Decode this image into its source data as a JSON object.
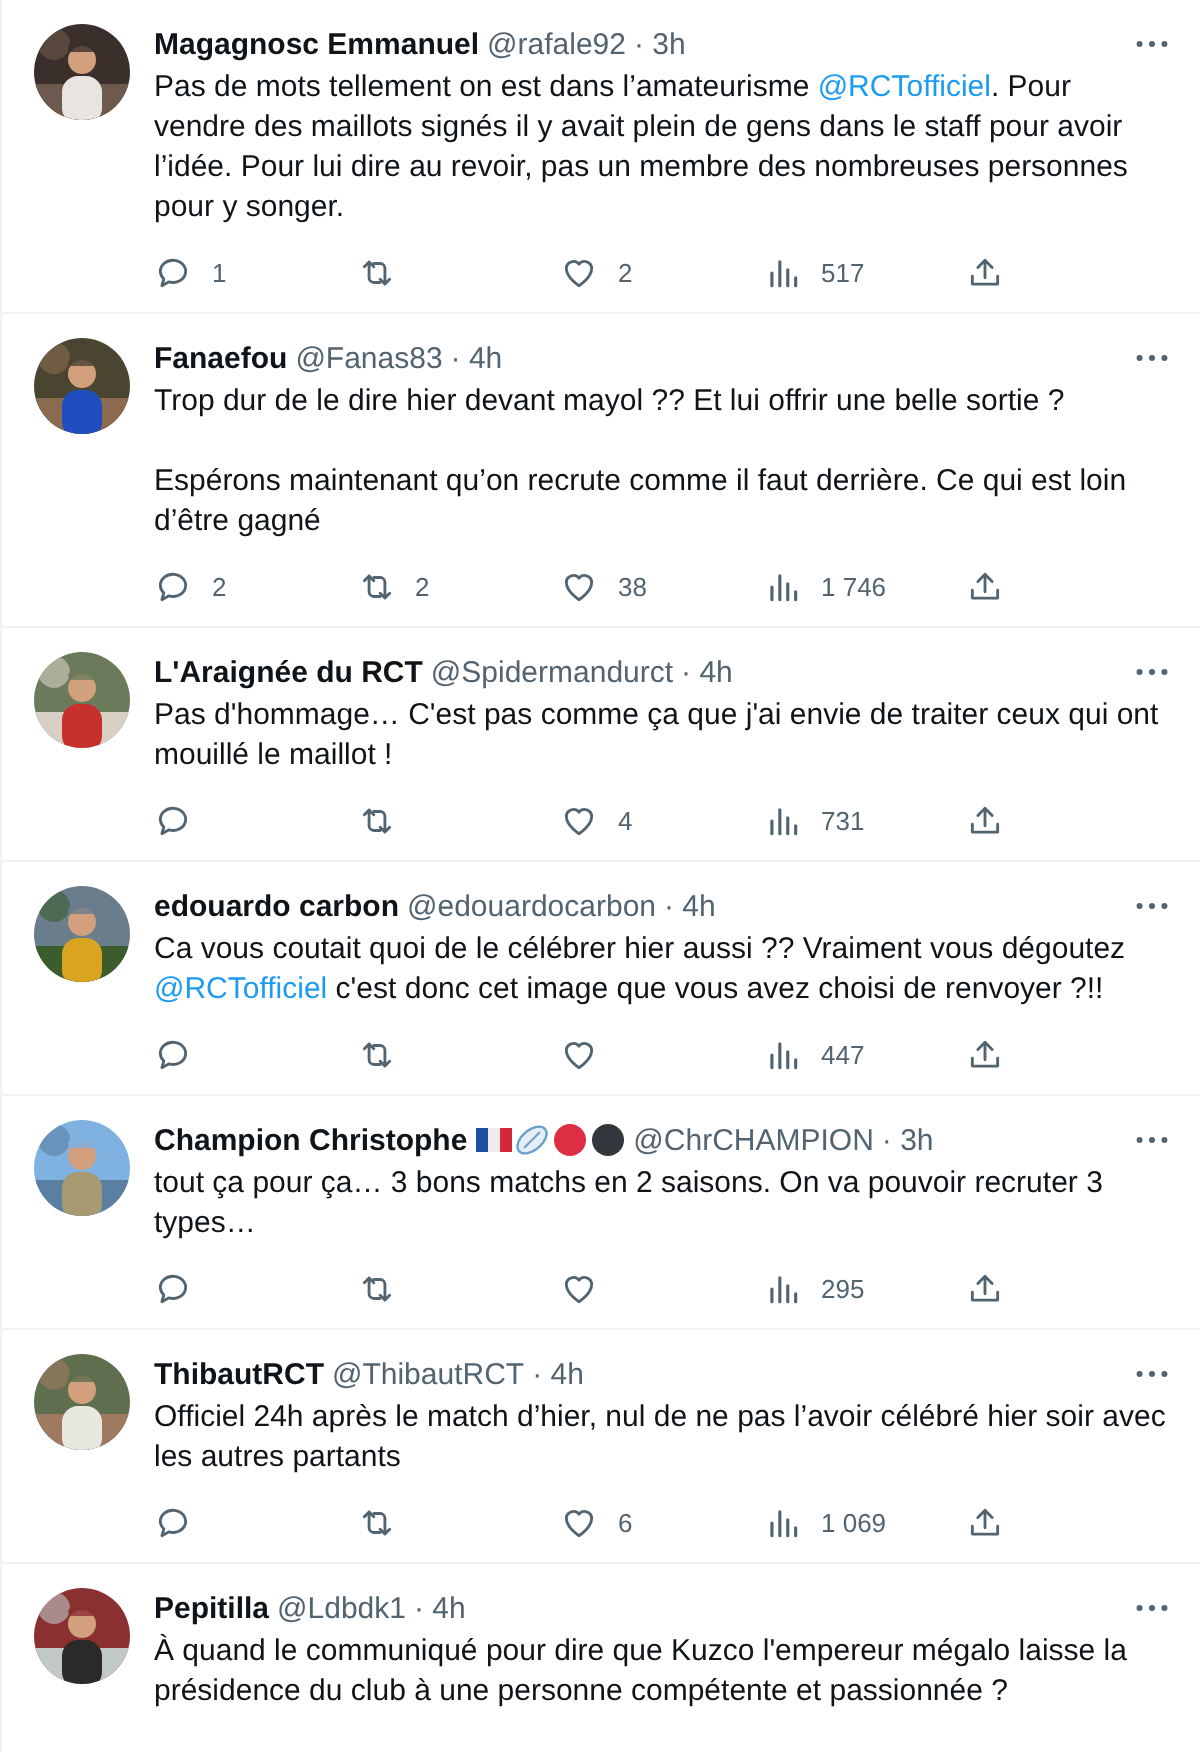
{
  "tweets": [
    {
      "name": "Magagnosc Emmanuel",
      "handle": "@rafale92",
      "time": "· 3h",
      "paragraphs": [
        [
          {
            "kind": "text",
            "text": "Pas de mots tellement on est dans l’amateurisme "
          },
          {
            "kind": "mention",
            "text": "@RCTofficiel"
          },
          {
            "kind": "text",
            "text": ". Pour vendre des maillots signés il y avait plein de gens dans le staff pour avoir l’idée. Pour lui dire au revoir, pas un membre des nombreuses personnes pour y songer."
          }
        ]
      ],
      "replies": "1",
      "likes": "2",
      "views": "517"
    },
    {
      "name": "Fanaefou",
      "handle": "@Fanas83",
      "time": "· 4h",
      "paragraphs": [
        [
          {
            "kind": "text",
            "text": "Trop dur de le dire hier devant mayol ?? Et lui offrir une belle sortie ?"
          }
        ],
        [
          {
            "kind": "text",
            "text": "Espérons maintenant qu’on recrute comme il faut derrière. Ce qui est loin d’être gagné"
          }
        ]
      ],
      "replies": "2",
      "retweets": "2",
      "likes": "38",
      "views": "1 746"
    },
    {
      "name": "L'Araignée du RCT",
      "handle": "@Spidermandurct",
      "time": "· 4h",
      "paragraphs": [
        [
          {
            "kind": "text",
            "text": "Pas d'hommage… C'est pas comme ça que j'ai envie de traiter ceux qui ont mouillé le maillot !"
          }
        ]
      ],
      "likes": "4",
      "views": "731"
    },
    {
      "name": "edouardo carbon",
      "handle": "@edouardocarbon",
      "time": "· 4h",
      "paragraphs": [
        [
          {
            "kind": "text",
            "text": "Ca vous coutait quoi de le célébrer hier aussi ??  Vraiment vous dégoutez "
          },
          {
            "kind": "mention",
            "text": "@RCTofficiel"
          },
          {
            "kind": "text",
            "text": "  c'est donc cet image que vous avez choisi de renvoyer ?!!"
          }
        ]
      ],
      "views": "447"
    },
    {
      "name": "Champion Christophe",
      "name_icons": [
        {
          "kind": "flag"
        },
        {
          "kind": "ball"
        },
        {
          "kind": "dot",
          "color": "#dd2e44"
        },
        {
          "kind": "dot",
          "color": "#31373d"
        }
      ],
      "handle": "@ChrCHAMPION",
      "time": "· 3h",
      "paragraphs": [
        [
          {
            "kind": "text",
            "text": "tout ça pour ça… 3 bons matchs en 2 saisons. On va pouvoir recruter 3 types…"
          }
        ]
      ],
      "views": "295"
    },
    {
      "name": "ThibautRCT",
      "handle": "@ThibautRCT",
      "time": "· 4h",
      "paragraphs": [
        [
          {
            "kind": "text",
            "text": "Officiel 24h après le match d’hier, nul de ne pas l’avoir célébré hier soir avec les autres partants"
          }
        ]
      ],
      "likes": "6",
      "views": "1 069"
    },
    {
      "name": "Pepitilla",
      "handle": "@Ldbdk1",
      "time": "· 4h",
      "paragraphs": [
        [
          {
            "kind": "text",
            "text": "À quand le communiqué pour dire que Kuzco l'empereur mégalo laisse la présidence du club à une personne compétente et passionnée ?"
          }
        ]
      ]
    }
  ]
}
